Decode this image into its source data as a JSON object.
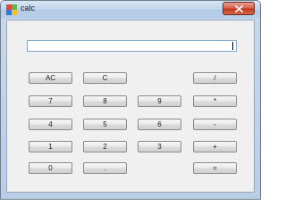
{
  "window": {
    "title": "calc",
    "close_label": "close"
  },
  "display": {
    "value": ""
  },
  "keys": {
    "clear_all": "AC",
    "clear": "C",
    "divide": "/",
    "seven": "7",
    "eight": "8",
    "nine": "9",
    "multiply": "*",
    "four": "4",
    "five": "5",
    "six": "6",
    "subtract": "-",
    "one": "1",
    "two": "2",
    "three": "3",
    "add": "+",
    "zero": "0",
    "decimal": ".",
    "equals": "="
  },
  "icons": {
    "app": "app-icon",
    "close": "close-x-icon"
  },
  "colors": {
    "titlebar": "#c2d5ec",
    "close_button": "#c2381d",
    "client_bg": "#f0f0f0",
    "display_border": "#7fa6c9"
  }
}
